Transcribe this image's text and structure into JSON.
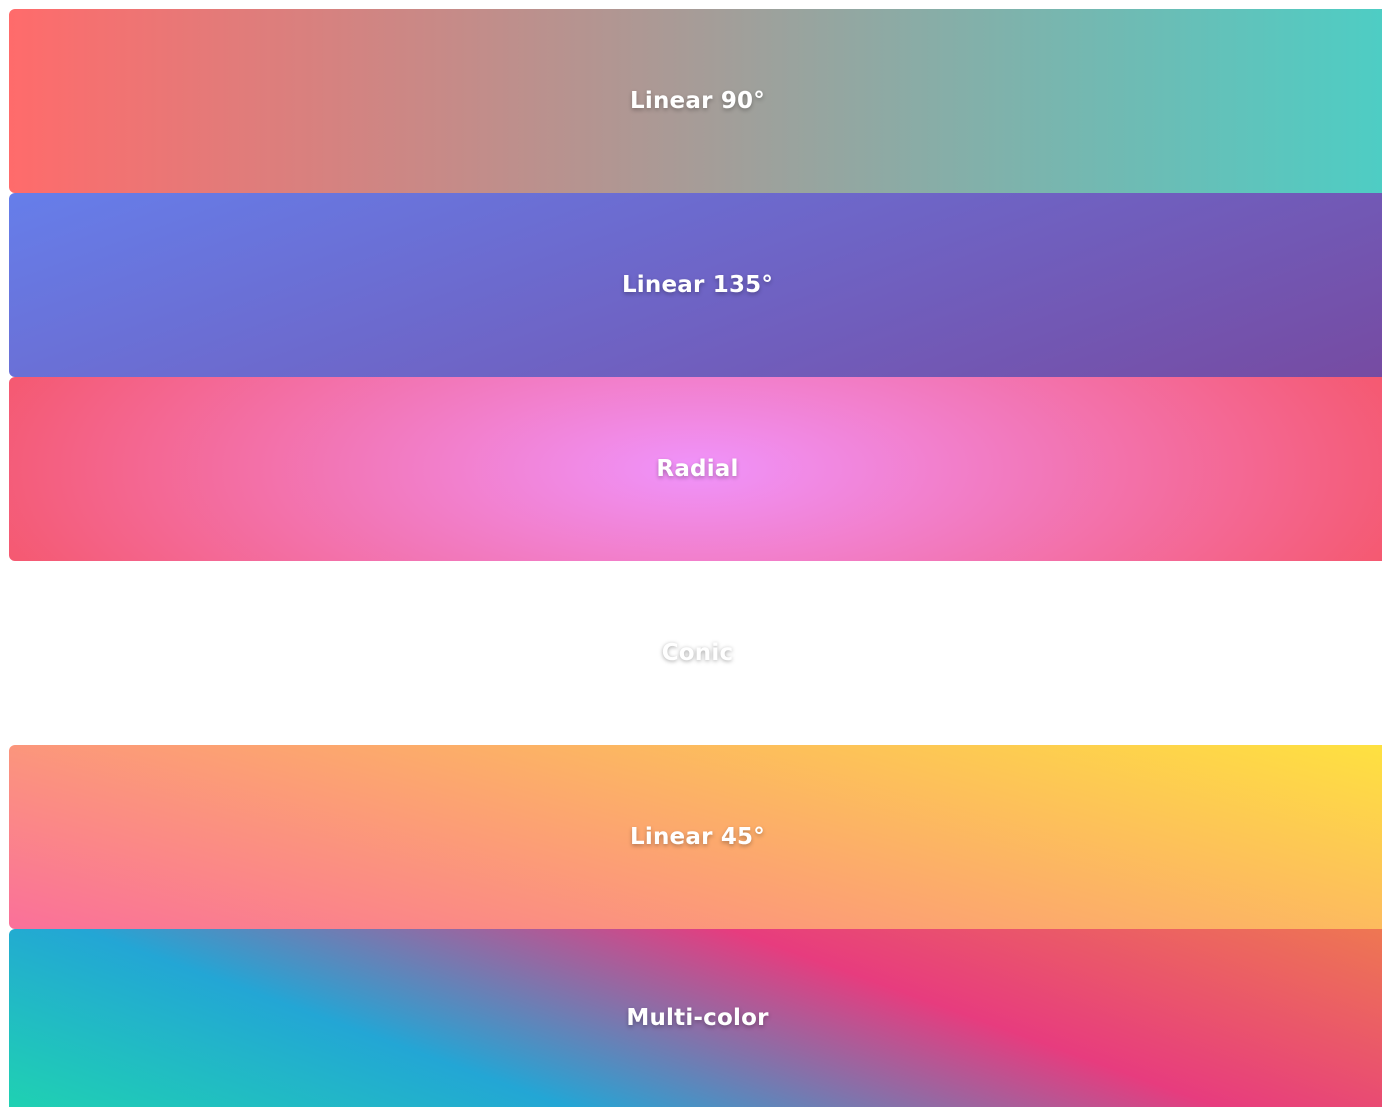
{
  "swatches": [
    {
      "label": "Linear 90°",
      "colors": [
        "#ff6b6b",
        "#4ecdc4"
      ]
    },
    {
      "label": "Linear 135°",
      "colors": [
        "#667eea",
        "#764ba2"
      ]
    },
    {
      "label": "Radial",
      "colors": [
        "#f093fb",
        "#f5576c"
      ]
    },
    {
      "label": "Conic",
      "colors": [
        "#ffffff"
      ]
    },
    {
      "label": "Linear 45°",
      "colors": [
        "#fa709a",
        "#fee140"
      ]
    },
    {
      "label": "Multi-color",
      "colors": [
        "#1fd1b2",
        "#23a6d5",
        "#e73c7e",
        "#ee7752"
      ]
    }
  ]
}
